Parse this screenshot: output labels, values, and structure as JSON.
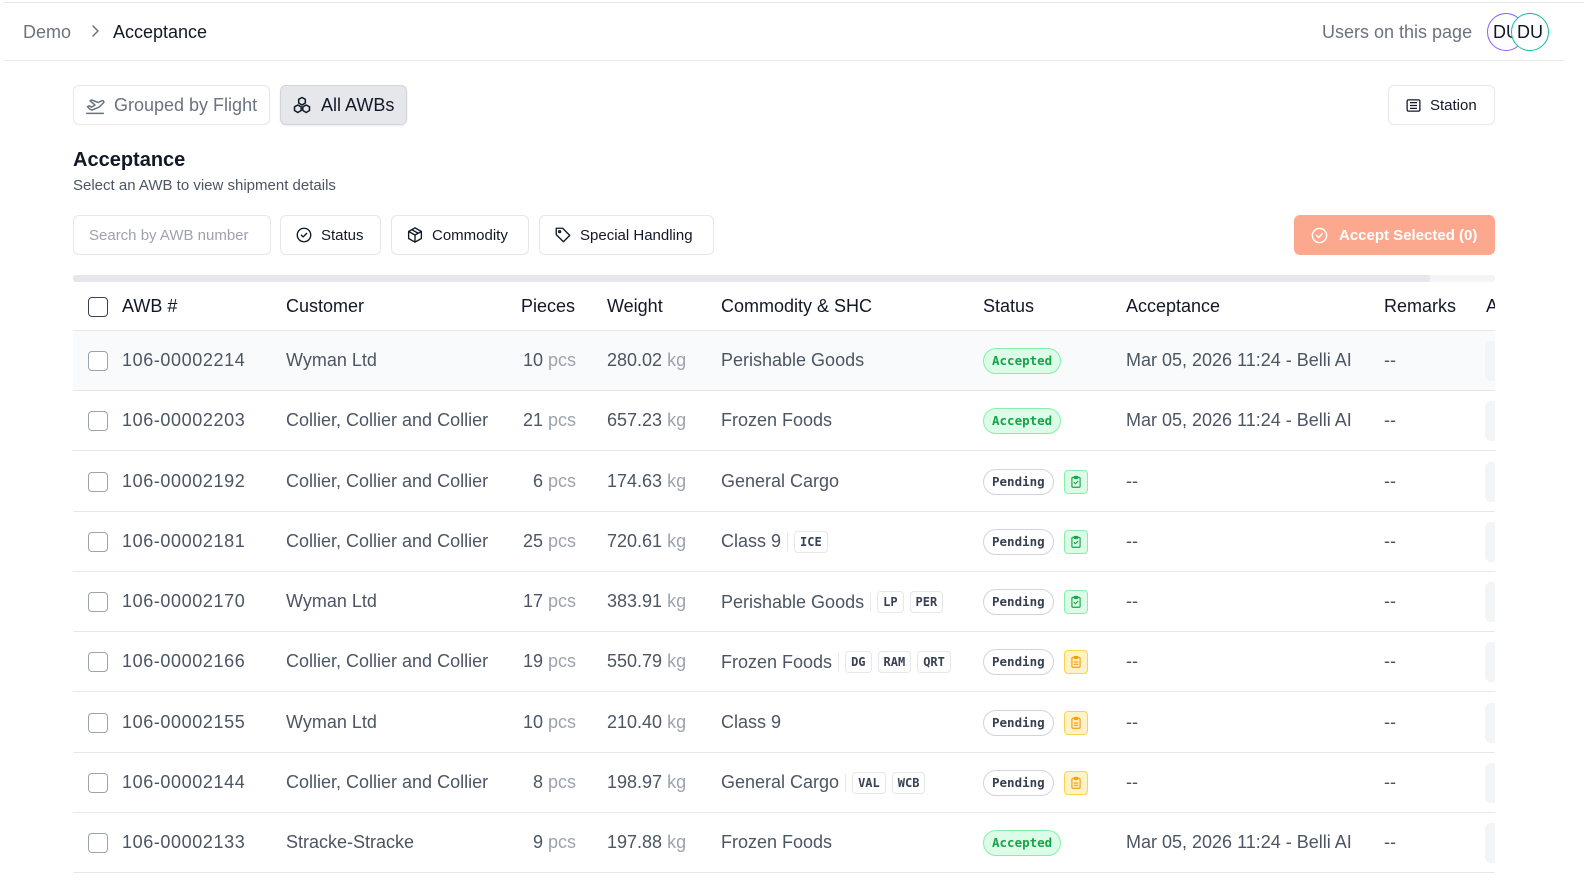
{
  "breadcrumb": {
    "root": "Demo",
    "current": "Acceptance"
  },
  "presence": {
    "label": "Users on this page",
    "users": [
      "DU",
      "DU"
    ]
  },
  "view_toggle": {
    "grouped": "Grouped by Flight",
    "all": "All AWBs",
    "active": "all"
  },
  "station_button": "Station",
  "page": {
    "title": "Acceptance",
    "subtitle": "Select an AWB to view shipment details"
  },
  "filters": {
    "search_placeholder": "Search by AWB number",
    "status": "Status",
    "commodity": "Commodity",
    "special_handling": "Special Handling"
  },
  "accept_button": "Accept Selected (0)",
  "columns": [
    "AWB #",
    "Customer",
    "Pieces",
    "Weight",
    "Commodity & SHC",
    "Status",
    "Acceptance",
    "Remarks",
    "A"
  ],
  "units": {
    "pieces": "pcs",
    "weight": "kg"
  },
  "colors": {
    "accent": "#fba88f",
    "accepted_bg": "#dcfce7",
    "accepted_text": "#16a34a",
    "warning": "#f59e0b"
  },
  "rows": [
    {
      "awb": "106-00002214",
      "customer": "Wyman Ltd",
      "pieces": "10",
      "weight": "280.02",
      "commodity": "Perishable Goods",
      "shc": [],
      "status": "Accepted",
      "doc": "",
      "acceptance": "Mar 05, 2026 11:24 - Belli AI",
      "remarks": "--"
    },
    {
      "awb": "106-00002203",
      "customer": "Collier, Collier and Collier",
      "pieces": "21",
      "weight": "657.23",
      "commodity": "Frozen Foods",
      "shc": [],
      "status": "Accepted",
      "doc": "",
      "acceptance": "Mar 05, 2026 11:24 - Belli AI",
      "remarks": "--"
    },
    {
      "awb": "106-00002192",
      "customer": "Collier, Collier and Collier",
      "pieces": "6",
      "weight": "174.63",
      "commodity": "General Cargo",
      "shc": [],
      "status": "Pending",
      "doc": "complete",
      "acceptance": "--",
      "remarks": "--"
    },
    {
      "awb": "106-00002181",
      "customer": "Collier, Collier and Collier",
      "pieces": "25",
      "weight": "720.61",
      "commodity": "Class 9",
      "shc": [
        "ICE"
      ],
      "status": "Pending",
      "doc": "complete",
      "acceptance": "--",
      "remarks": "--"
    },
    {
      "awb": "106-00002170",
      "customer": "Wyman Ltd",
      "pieces": "17",
      "weight": "383.91",
      "commodity": "Perishable Goods",
      "shc": [
        "LP",
        "PER"
      ],
      "status": "Pending",
      "doc": "complete",
      "acceptance": "--",
      "remarks": "--"
    },
    {
      "awb": "106-00002166",
      "customer": "Collier, Collier and Collier",
      "pieces": "19",
      "weight": "550.79",
      "commodity": "Frozen Foods",
      "shc": [
        "DG",
        "RAM",
        "QRT"
      ],
      "status": "Pending",
      "doc": "incomplete",
      "acceptance": "--",
      "remarks": "--"
    },
    {
      "awb": "106-00002155",
      "customer": "Wyman Ltd",
      "pieces": "10",
      "weight": "210.40",
      "commodity": "Class 9",
      "shc": [],
      "status": "Pending",
      "doc": "incomplete",
      "acceptance": "--",
      "remarks": "--"
    },
    {
      "awb": "106-00002144",
      "customer": "Collier, Collier and Collier",
      "pieces": "8",
      "weight": "198.97",
      "commodity": "General Cargo",
      "shc": [
        "VAL",
        "WCB"
      ],
      "status": "Pending",
      "doc": "incomplete",
      "acceptance": "--",
      "remarks": "--"
    },
    {
      "awb": "106-00002133",
      "customer": "Stracke-Stracke",
      "pieces": "9",
      "weight": "197.88",
      "commodity": "Frozen Foods",
      "shc": [],
      "status": "Accepted",
      "doc": "",
      "acceptance": "Mar 05, 2026 11:24 - Belli AI",
      "remarks": "--"
    }
  ]
}
